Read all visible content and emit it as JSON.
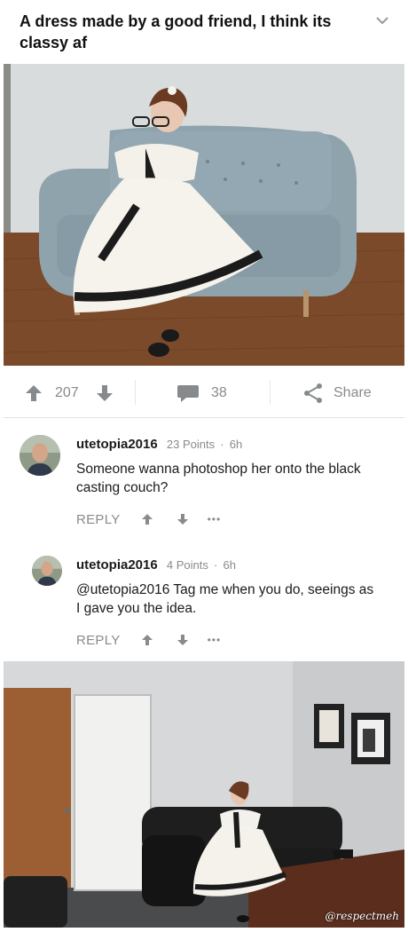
{
  "post": {
    "title": "A dress made by a good friend, I think its classy af",
    "collapse_icon": "chevron-down-icon"
  },
  "action_bar": {
    "score": "207",
    "comment_count": "38",
    "share_label": "Share",
    "icons": [
      "upvote-icon",
      "downvote-icon",
      "comment-icon",
      "share-icon"
    ]
  },
  "comments": [
    {
      "username": "utetopia2016",
      "points": "23 Points",
      "time": "6h",
      "body": "Someone wanna photoshop her onto the black casting couch?",
      "reply_label": "REPLY",
      "more_label": "•••"
    },
    {
      "username": "utetopia2016",
      "points": "4 Points",
      "time": "6h",
      "body": "@utetopia2016 Tag me when you do, seeings as I gave you the idea.",
      "reply_label": "REPLY",
      "more_label": "•••"
    }
  ],
  "bottom_image": {
    "watermark": "@respectmeh"
  },
  "colors": {
    "icon_gray": "#878a8c",
    "text": "#1a1a1b",
    "meta": "#8a8a8a"
  }
}
